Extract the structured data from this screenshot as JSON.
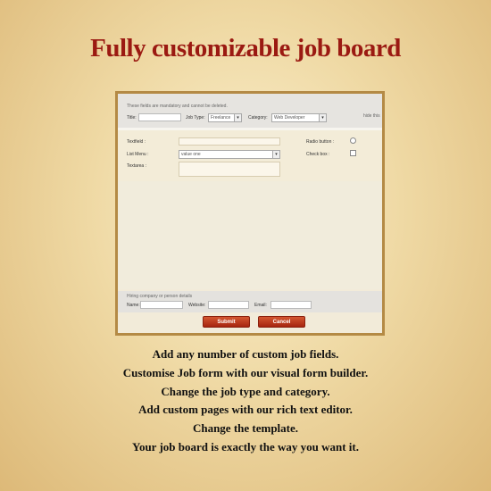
{
  "headline": "Fully customizable job board",
  "form": {
    "mandatory_note": "These fields are mandatory and cannot be deleted.",
    "title_label": "Title:",
    "title_value": "",
    "job_type_label": "Job Type:",
    "job_type_value": "Freelance",
    "category_label": "Category:",
    "category_value": "Web Developer",
    "hide_label": "hide this",
    "custom": {
      "textfield_label": "Textfield :",
      "listmenu_label": "List Menu :",
      "listmenu_value": "value one",
      "textarea_label": "Textarea :",
      "radio_label": "Radio button :",
      "checkbox_label": "Check box :"
    },
    "hiring_note": "Hiring company or person details",
    "name_label": "Name:",
    "website_label": "Website:",
    "email_label": "Email:",
    "submit_label": "Submit",
    "cancel_label": "Cancel"
  },
  "features": [
    "Add any number of custom job fields.",
    "Customise Job form with our visual form builder.",
    "Change the job type and category.",
    "Add custom pages with our rich text editor.",
    "Change the template.",
    "Your job board is exactly the way you want it."
  ],
  "colors": {
    "headline": "#9b1a12",
    "frame_border": "#b48a45",
    "button": "#b8321a"
  },
  "icons": {
    "dropdown": "chevron-down-icon"
  }
}
